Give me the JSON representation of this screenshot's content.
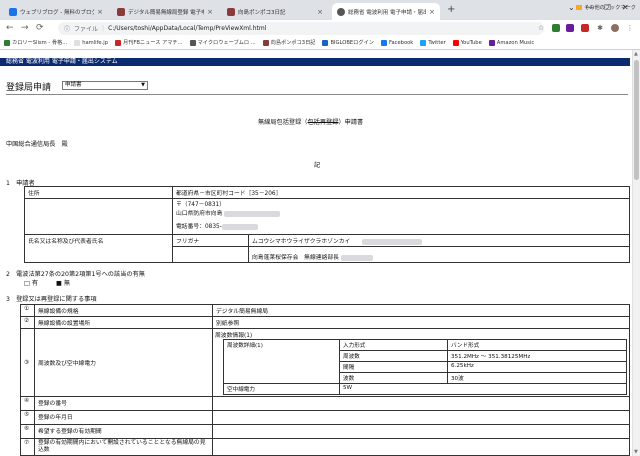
{
  "browser": {
    "tabs": [
      {
        "title": "ウェブリブログ - 無料のブログ(blog)サ",
        "color": "#1a73e8",
        "active": false
      },
      {
        "title": "デジタル簡易無線局登録 電子申請",
        "color": "#8b3a3a",
        "active": false
      },
      {
        "title": "向島ポンポコ3日記",
        "color": "#8b3a3a",
        "active": false
      },
      {
        "title": "総務省 電波利用 電子申請・届出",
        "color": "#555555",
        "active": true
      }
    ],
    "new_tab": "+",
    "window_controls": [
      "⌄",
      "—",
      "☐",
      "✕"
    ],
    "url_label": "ファイル",
    "url": "C:/Users/toshi/AppData/Local/Temp/PreViewXml.html"
  },
  "bookmarks": [
    {
      "label": "カロリーSlism - 骨格...",
      "color": "#2e7d32"
    },
    {
      "label": "hamlife.jp",
      "color": "#e0e0e0"
    },
    {
      "label": "月刊FBニュース アマチ...",
      "color": "#c62828"
    },
    {
      "label": "マイクロウェーブムロ ...",
      "color": "#555555"
    },
    {
      "label": "向島ポンポコ3日記",
      "color": "#8b3a3a"
    },
    {
      "label": "BIGLOBEログイン",
      "color": "#1565c0"
    },
    {
      "label": "Facebook",
      "color": "#1877f2"
    },
    {
      "label": "Twitter",
      "color": "#1da1f2"
    },
    {
      "label": "YouTube",
      "color": "#ff0000"
    },
    {
      "label": "Amazon Music",
      "color": "#6a1b9a"
    }
  ],
  "bookmarks_other": "その他のブックマーク",
  "page": {
    "banner": "総務省 電波利用 電子申請・届出システム",
    "heading": "登録局申請",
    "select_value": "申請書",
    "form_title_a": "無線局包括登録（",
    "form_title_strike": "包括再登録",
    "form_title_b": "）申請書",
    "addressee": "中国総合通信局長　殿",
    "ki": "記",
    "sec1_title": "1　申請者",
    "applicant": {
      "address_label": "住所",
      "address_code": "都道府県－市区町村コード［35－206］",
      "postal": "〒（747－0831）",
      "city": "山口県防府市向島",
      "phone_label": "電話番号：0835-",
      "name_label": "氏名又は名称及び代表者氏名",
      "furigana_label": "フリガナ",
      "furigana": "ムコウシマホウライザクラホゾンカイ",
      "name_value": "向島蓬莱桜保存会　無線連絡部長"
    },
    "sec2_title": "2　電波法第27条の20第2項第1号への該当の有無",
    "sec2_opt1": "□ 有",
    "sec2_opt2": "■ 無",
    "sec3_title": "3　登録又は再登録に関する事項",
    "rows": [
      {
        "num": "①",
        "label": "無線設備の規格",
        "value": "デジタル簡易無線局"
      },
      {
        "num": "②",
        "label": "無線設備の設置場所",
        "value": "別紙参照"
      },
      {
        "num": "③",
        "label": "周波数及び空中線電力",
        "value": ""
      },
      {
        "num": "④",
        "label": "登録の番号",
        "value": ""
      },
      {
        "num": "⑤",
        "label": "登録の年月日",
        "value": ""
      },
      {
        "num": "⑥",
        "label": "希望する登録の有効期間",
        "value": ""
      },
      {
        "num": "⑦",
        "label": "登録の有効期間内において開設されていることとなる無線局の見込数",
        "value": ""
      }
    ],
    "freq": {
      "info_label": "周波数情報(1)",
      "sub_label": "周波数詳細(1)",
      "input_label": "入力形式",
      "input_value": "バンド形式",
      "freq_label": "周波数",
      "freq_value": "351.2MHz ～ 351.38125MHz",
      "spacing_label": "間隔",
      "spacing_value": "6.25kHz",
      "count_label": "波数",
      "count_value": "30波",
      "power_label": "空中線電力",
      "power_value": "5W"
    }
  }
}
